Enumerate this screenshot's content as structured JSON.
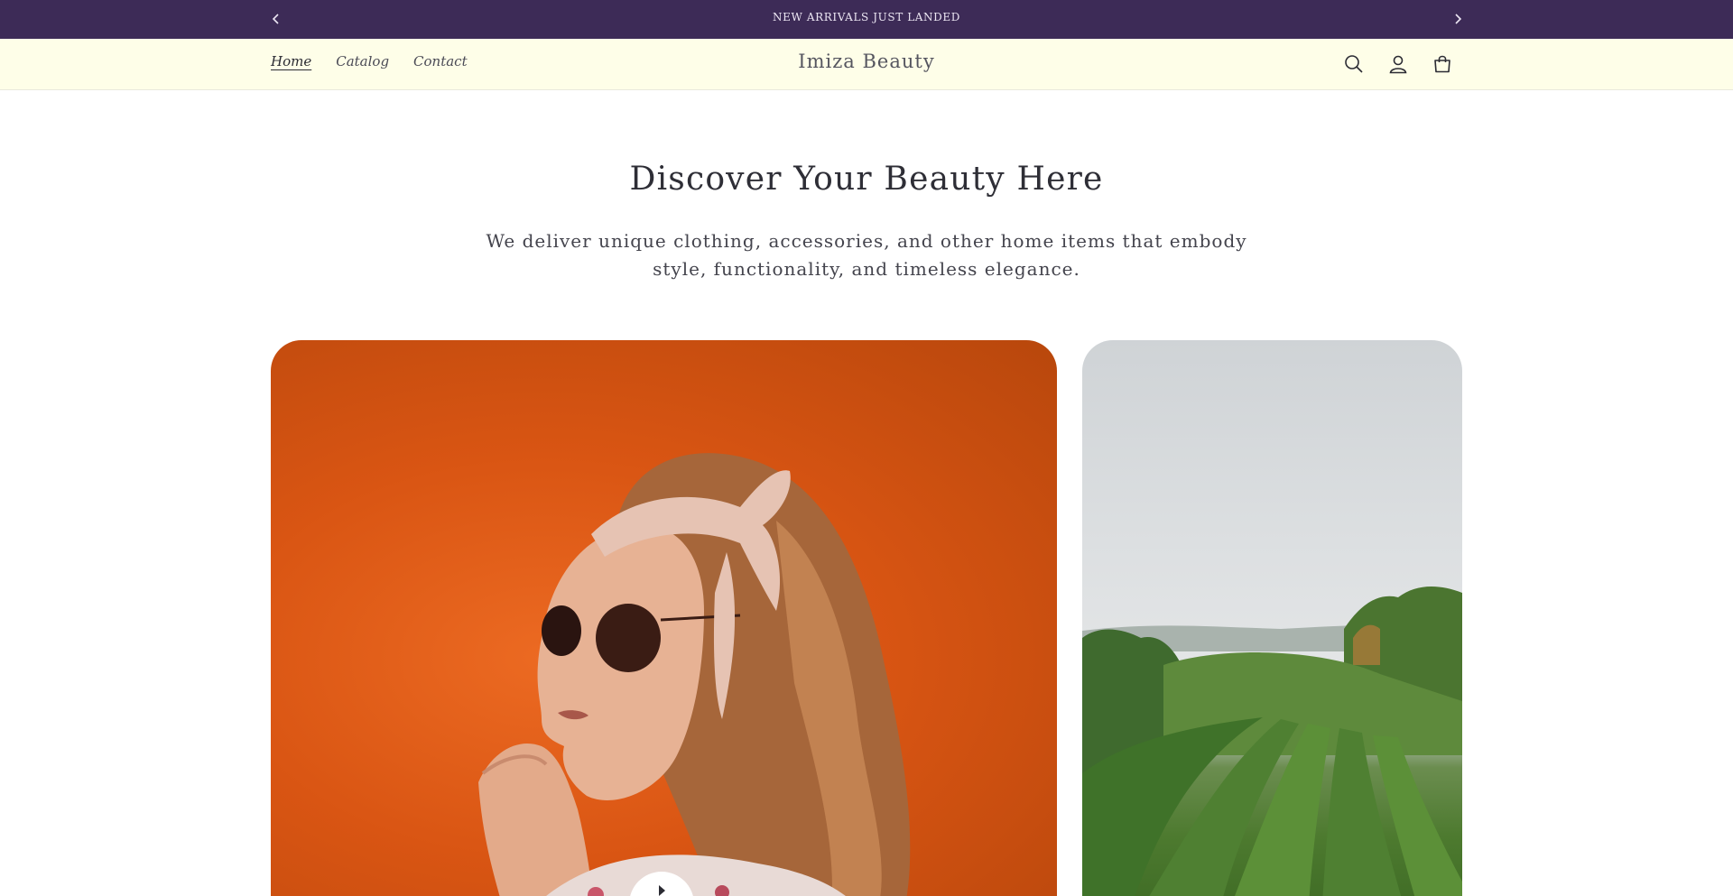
{
  "announcement": {
    "text": "NEW ARRIVALS JUST LANDED",
    "prev_icon": "chevron-left-icon",
    "next_icon": "chevron-right-icon"
  },
  "header": {
    "brand": "Imiza Beauty",
    "nav": [
      {
        "label": "Home",
        "active": true
      },
      {
        "label": "Catalog",
        "active": false
      },
      {
        "label": "Contact",
        "active": false
      }
    ],
    "icons": [
      "search-icon",
      "account-icon",
      "cart-icon"
    ]
  },
  "hero": {
    "title": "Discover Your Beauty Here",
    "subtitle": "We deliver unique clothing, accessories, and other home items that embody style, functionality, and timeless elegance."
  },
  "media": {
    "left_image": "woman-with-sunglasses-orange-background",
    "right_image": "green-tea-field-landscape",
    "play_icon": "play-icon"
  },
  "colors": {
    "announcement_bg": "#3d2b57",
    "header_bg": "#fefee8",
    "hero_left_bg": "#d95513"
  }
}
